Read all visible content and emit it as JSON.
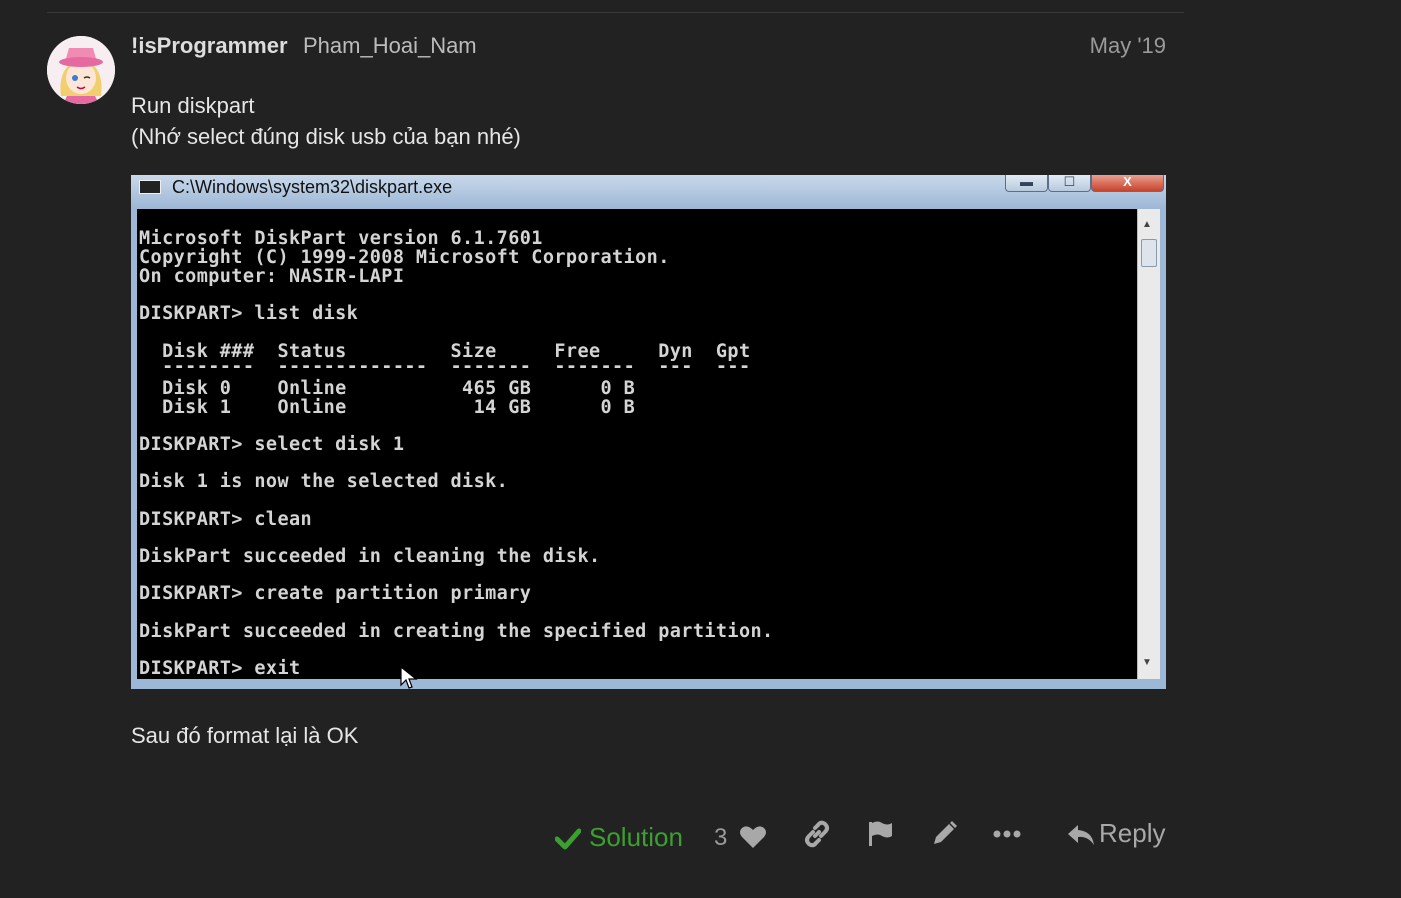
{
  "post": {
    "username": "!isProgrammer",
    "full_name": "Pham_Hoai_Nam",
    "date": "May '19",
    "line1": "Run diskpart",
    "line2": "(Nhớ select đúng disk usb của bạn nhé)",
    "line3": "Sau đó format lại là OK"
  },
  "screenshot": {
    "window_title": "C:\\Windows\\system32\\diskpart.exe",
    "min_glyph": "▬",
    "max_glyph": "☐",
    "close_glyph": "X",
    "console_lines": [
      "Microsoft DiskPart version 6.1.7601",
      "Copyright (C) 1999-2008 Microsoft Corporation.",
      "On computer: NASIR-LAPI",
      "DISKPART> list disk",
      "  Disk ###  Status         Size     Free     Dyn  Gpt",
      "  --------  -------------  -------  -------  ---  ---",
      "  Disk 0    Online          465 GB      0 B",
      "  Disk 1    Online           14 GB      0 B",
      "DISKPART> select disk 1",
      "Disk 1 is now the selected disk.",
      "DISKPART> clean",
      "DiskPart succeeded in cleaning the disk.",
      "DISKPART> create partition primary",
      "DiskPart succeeded in creating the specified partition.",
      "DISKPART> exit"
    ]
  },
  "actions": {
    "solution_label": "Solution",
    "like_count": "3",
    "reply_label": "Reply"
  },
  "colors": {
    "background": "#222222",
    "solution_green": "#3aa02e"
  }
}
